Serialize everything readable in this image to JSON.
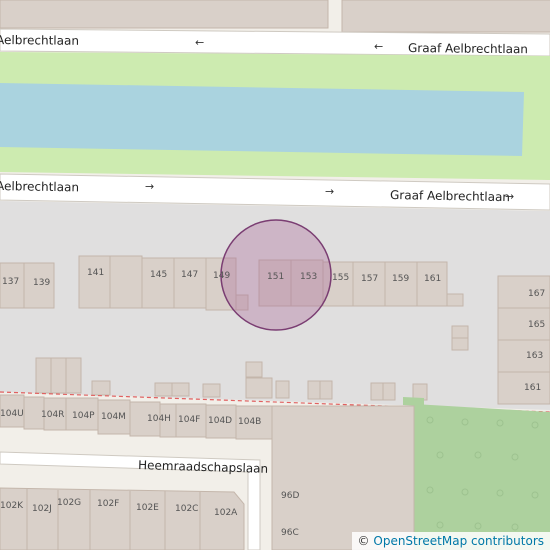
{
  "map": {
    "colors": {
      "background": "#f2efe9",
      "road": "#ffffff",
      "road_casing": "#cfcac2",
      "grass": "#cdebb0",
      "water": "#aad3df",
      "park": "#add19e",
      "building": "#d9d0c9",
      "building_outline": "#c4b6ab",
      "marker_fill": "#aa6699",
      "marker_stroke": "#7a3d72",
      "railway": "#e06060"
    },
    "streets": {
      "top_left": "Aelbrechtlaan",
      "top_right": "Graaf Aelbrechtlaan",
      "mid_left": "Aelbrechtlaan",
      "mid_right": "Graaf Aelbrechtlaan",
      "bottom": "Heemraadschapslaan"
    },
    "arrows": {
      "left": "←",
      "right": "→"
    },
    "house_numbers": {
      "n137": "137",
      "n139": "139",
      "n141": "141",
      "n145": "145",
      "n147": "147",
      "n149": "149",
      "n151": "151",
      "n153": "153",
      "n155": "155",
      "n157": "157",
      "n159": "159",
      "n161": "161",
      "e167": "167",
      "e165": "165",
      "e163": "163",
      "e161": "161",
      "n104U": "104U",
      "n104R": "104R",
      "n104P": "104P",
      "n104M": "104M",
      "n104H": "104H",
      "n104F": "104F",
      "n104D": "104D",
      "n104B": "104B",
      "n96D": "96D",
      "n96C": "96C",
      "n102K": "102K",
      "n102J": "102J",
      "n102G": "102G",
      "n102F": "102F",
      "n102E": "102E",
      "n102C": "102C",
      "n102A": "102A"
    }
  },
  "attribution": {
    "copyright": "©",
    "link_text": "OpenStreetMap contributors"
  }
}
